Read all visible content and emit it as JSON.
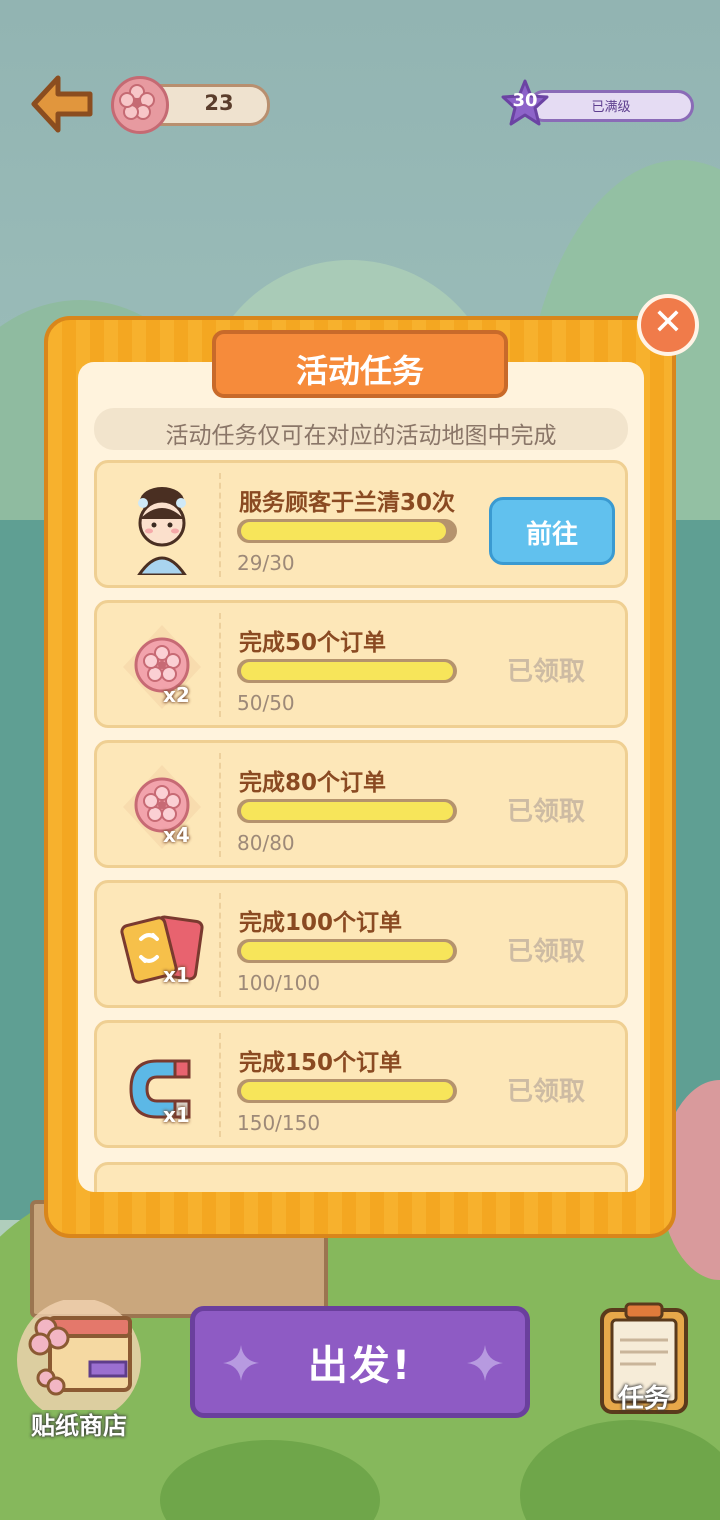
{
  "top": {
    "coins": "23",
    "level": "30",
    "level_status": "已满级"
  },
  "dialog": {
    "title": "活动任务",
    "notice": "活动任务仅可在对应的活动地图中完成",
    "tasks": [
      {
        "title": "服务顾客于兰清30次",
        "progress_text": "29/30",
        "progress": 0.967,
        "action": "前往",
        "icon": "character-portrait-icon",
        "qty": ""
      },
      {
        "title": "完成50个订单",
        "progress_text": "50/50",
        "progress": 1.0,
        "action": "已领取",
        "icon": "flower-coin-icon",
        "qty": "x2"
      },
      {
        "title": "完成80个订单",
        "progress_text": "80/80",
        "progress": 1.0,
        "action": "已领取",
        "icon": "flower-coin-icon",
        "qty": "x4"
      },
      {
        "title": "完成100个订单",
        "progress_text": "100/100",
        "progress": 1.0,
        "action": "已领取",
        "icon": "swap-cards-icon",
        "qty": "x1"
      },
      {
        "title": "完成150个订单",
        "progress_text": "150/150",
        "progress": 1.0,
        "action": "已领取",
        "icon": "magnet-icon",
        "qty": "x1"
      }
    ]
  },
  "bottom": {
    "shop_label": "贴纸商店",
    "depart_label": "出发!",
    "mission_label": "任务"
  }
}
